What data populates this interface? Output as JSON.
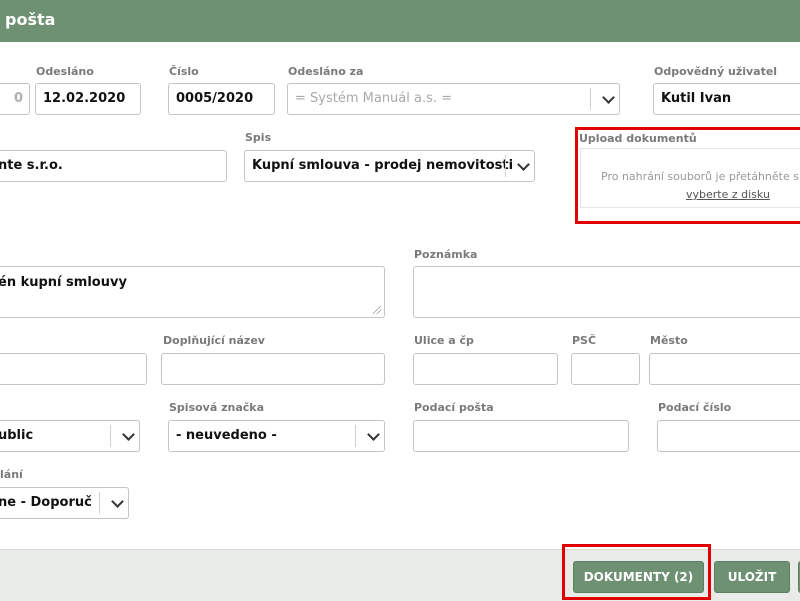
{
  "header": {
    "title": "pošta"
  },
  "row1": {
    "partial_value": "0",
    "sent_label": "Odesláno",
    "sent_value": "12.02.2020",
    "number_label": "Číslo",
    "number_value": "0005/2020",
    "sent_for_label": "Odesláno za",
    "sent_for_value": "= Systém Manuál a.s. =",
    "responsible_label": "Odpovědný uživatel",
    "responsible_value": "Kutil Ivan"
  },
  "row2": {
    "company_value": "nte s.r.o.",
    "spis_label": "Spis",
    "spis_value": "Kupní smlouva - prodej nemovitosti"
  },
  "upload": {
    "label": "Upload dokumentů",
    "drop_text": "Pro nahrání souborů je přetáhněte s",
    "link": "vyberte z disku"
  },
  "row3": {
    "subject_value": "én kupní smlouvy",
    "note_label": "Poznámka",
    "note_value": ""
  },
  "row4": {
    "extra_name_label": "Doplňující název",
    "street_label": "Ulice a čp",
    "zip_label": "PSČ",
    "city_label": "Město"
  },
  "row5": {
    "type_value": "ublic",
    "file_mark_label": "Spisová značka",
    "file_mark_value": "- neuvedeno -",
    "post_office_label": "Podací pošta",
    "post_number_label": "Podací číslo"
  },
  "row6": {
    "delivery_label": "lání",
    "delivery_value": "ne - Doporuč"
  },
  "footer": {
    "documents_button": "DOKUMENTY (2)",
    "save_button": "ULOŽIT"
  },
  "colors": {
    "accent": "#6e9173",
    "highlight": "#e00000"
  }
}
